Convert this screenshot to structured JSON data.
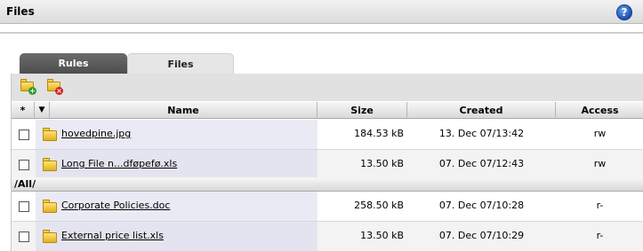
{
  "window": {
    "title": "Files",
    "help_label": "?"
  },
  "tabs": [
    {
      "label": "Rules",
      "active": false
    },
    {
      "label": "Files",
      "active": true
    }
  ],
  "toolbar": [
    {
      "icon": "add-folder-icon"
    },
    {
      "icon": "delete-folder-icon"
    }
  ],
  "table": {
    "headers": {
      "select": "*",
      "sort": "▼",
      "name": "Name",
      "size": "Size",
      "created": "Created",
      "access": "Access"
    },
    "rows_top": [
      {
        "name": "hovedpine.jpg",
        "size": "184.53 kB",
        "created": "13. Dec 07/13:42",
        "access": "rw"
      },
      {
        "name": "Long File n...dføpefø.xls",
        "size": "13.50 kB",
        "created": "07. Dec 07/12:43",
        "access": "rw"
      }
    ],
    "group_label": "/All/",
    "rows_group": [
      {
        "name": "Corporate Policies.doc",
        "size": "258.50 kB",
        "created": "07. Dec 07/10:28",
        "access": "r-"
      },
      {
        "name": "External price list.xls",
        "size": "13.50 kB",
        "created": "07. Dec 07/10:29",
        "access": "r-"
      }
    ]
  },
  "colors": {
    "tab_inactive": "#555555",
    "toolbar": "#e1e1e1",
    "name_column": "#eaeaf4",
    "help": "#1a4fb3"
  }
}
